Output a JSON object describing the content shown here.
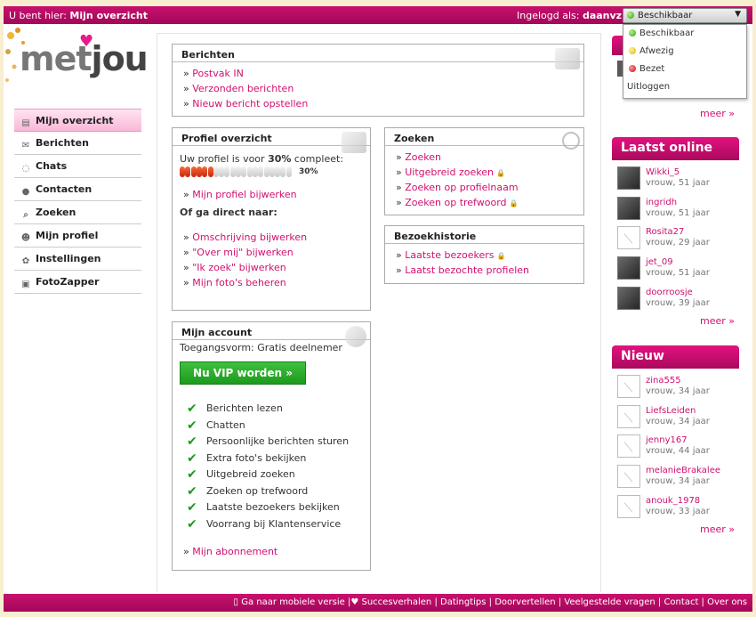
{
  "topbar": {
    "crumb_prefix": "U bent hier:",
    "crumb_current": "Mijn overzicht",
    "login_prefix": "Ingelogd als:",
    "username": "daanvz"
  },
  "status": {
    "selected": "Beschikbaar",
    "options": [
      "Beschikbaar",
      "Afwezig",
      "Bezet"
    ],
    "logout": "Uitloggen"
  },
  "logo": {
    "part1": "met",
    "part2": "jou"
  },
  "nav": [
    {
      "label": "Mijn overzicht",
      "icon": "id-card-icon"
    },
    {
      "label": "Berichten",
      "icon": "envelope-icon"
    },
    {
      "label": "Chats",
      "icon": "chat-bubbles-icon"
    },
    {
      "label": "Contacten",
      "icon": "contacts-icon"
    },
    {
      "label": "Zoeken",
      "icon": "magnifier-icon"
    },
    {
      "label": "Mijn profiel",
      "icon": "user-icon"
    },
    {
      "label": "Instellingen",
      "icon": "gear-icon"
    },
    {
      "label": "FotoZapper",
      "icon": "photo-icon"
    }
  ],
  "berichten": {
    "title": "Berichten",
    "links": [
      "Postvak IN",
      "Verzonden berichten",
      "Nieuw bericht opstellen"
    ]
  },
  "profiel": {
    "title": "Profiel overzicht",
    "complete_pre": "Uw profiel is voor",
    "complete_pct": "30%",
    "complete_post": "compleet:",
    "progress_fraction": 0.3,
    "pct_label": "30%",
    "link_update": "Mijn profiel bijwerken",
    "direct_heading": "Of ga direct naar:",
    "direct_links": [
      "Omschrijving bijwerken",
      "\"Over mij\" bijwerken",
      "\"Ik zoek\" bijwerken",
      "Mijn foto's beheren"
    ]
  },
  "zoeken": {
    "title": "Zoeken",
    "links": [
      {
        "label": "Zoeken",
        "locked": false
      },
      {
        "label": "Uitgebreid zoeken",
        "locked": true
      },
      {
        "label": "Zoeken op profielnaam",
        "locked": false
      },
      {
        "label": "Zoeken op trefwoord",
        "locked": true
      }
    ]
  },
  "historie": {
    "title": "Bezoekhistorie",
    "links": [
      {
        "label": "Laatste bezoekers",
        "locked": true
      },
      {
        "label": "Laatst bezochte profielen",
        "locked": false
      }
    ]
  },
  "account": {
    "title": "Mijn account",
    "access_label": "Toegangsvorm: Gratis deelnemer",
    "vip_button": "Nu VIP worden »",
    "features": [
      "Berichten lezen",
      "Chatten",
      "Persoonlijke berichten sturen",
      "Extra foto's bekijken",
      "Uitgebreid zoeken",
      "Zoeken op trefwoord",
      "Laatste bezoekers bekijken",
      "Voorrang bij Klantenservice"
    ],
    "subscription_link": "Mijn abonnement"
  },
  "right": {
    "meer": "meer »",
    "online_title": "Laatst online",
    "online": [
      {
        "name": "Wikki_5",
        "info": "vrouw, 51 jaar",
        "photo": true
      },
      {
        "name": "ingridh",
        "info": "vrouw, 51 jaar",
        "photo": true
      },
      {
        "name": "Rosita27",
        "info": "vrouw, 29 jaar",
        "photo": false
      },
      {
        "name": "jet_09",
        "info": "vrouw, 51 jaar",
        "photo": true
      },
      {
        "name": "doorroosje",
        "info": "vrouw, 39 jaar",
        "photo": true
      }
    ],
    "new_title": "Nieuw",
    "new": [
      {
        "name": "zina555",
        "info": "vrouw, 34 jaar"
      },
      {
        "name": "LiefsLeiden",
        "info": "vrouw, 34 jaar"
      },
      {
        "name": "jenny167",
        "info": "vrouw, 44 jaar"
      },
      {
        "name": "melanieBrakalee",
        "info": "vrouw, 34 jaar"
      },
      {
        "name": "anouk_1978",
        "info": "vrouw, 33 jaar"
      }
    ]
  },
  "footer": {
    "links": [
      "Ga naar mobiele versie",
      "Succesverhalen",
      "Datingtips",
      "Doorvertellen",
      "Veelgestelde vragen",
      "Contact",
      "Over ons"
    ]
  }
}
